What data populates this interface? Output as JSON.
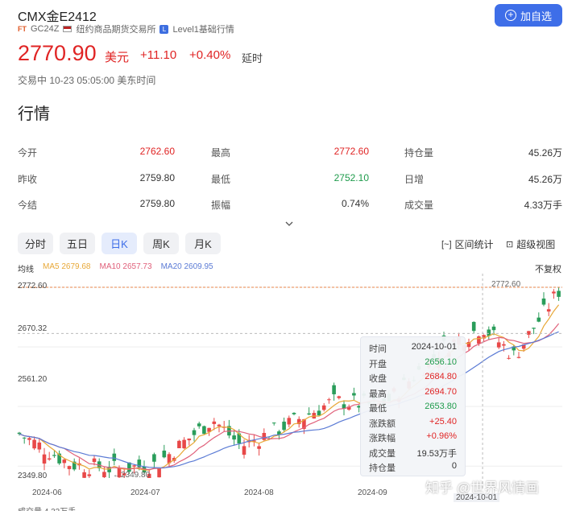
{
  "header": {
    "title": "CMX金E2412",
    "tag": "FT",
    "code": "GC24Z",
    "exchange": "纽约商品期货交易所",
    "level_badge": "L",
    "level": "Level1基础行情",
    "add_label": "加自选"
  },
  "quote": {
    "price": "2770.90",
    "unit": "美元",
    "change": "+11.10",
    "change_pct": "+0.40%",
    "delay": "延时",
    "status": "交易中 10-23 05:05:00 美东时间"
  },
  "section_title": "行情",
  "stats": [
    {
      "label": "今开",
      "value": "2762.60",
      "color": "red"
    },
    {
      "label": "最高",
      "value": "2772.60",
      "color": "red"
    },
    {
      "label": "持仓量",
      "value": "45.26万",
      "color": "blk"
    },
    {
      "label": "昨收",
      "value": "2759.80",
      "color": "blk"
    },
    {
      "label": "最低",
      "value": "2752.10",
      "color": "grn"
    },
    {
      "label": "日增",
      "value": "45.26万",
      "color": "blk"
    },
    {
      "label": "今结",
      "value": "2759.80",
      "color": "blk"
    },
    {
      "label": "振幅",
      "value": "0.74%",
      "color": "blk"
    },
    {
      "label": "成交量",
      "value": "4.33万手",
      "color": "blk"
    }
  ],
  "tabs": [
    "分时",
    "五日",
    "日K",
    "周K",
    "月K"
  ],
  "active_tab": "日K",
  "tools": {
    "range_stats": "区间统计",
    "super_view": "超级视图"
  },
  "ma": {
    "label": "均线",
    "ma5": "MA5 2679.68",
    "ma10": "MA10 2657.73",
    "ma20": "MA20 2609.95",
    "ma5_color": "#e8a838",
    "ma10_color": "#e0607a",
    "ma20_color": "#5b7bd5"
  },
  "no_adjust": "不复权",
  "axis": {
    "y_ticks": [
      "2772.60",
      "2670.32",
      "2561.20",
      "2349.80"
    ],
    "x_ticks": [
      "2024-06",
      "2024-07",
      "2024-08",
      "2024-09",
      "2024-10-01"
    ],
    "high_label": "2772.60",
    "low_label": "2349.80"
  },
  "tooltip": [
    {
      "label": "时间",
      "value": "2024-10-01",
      "color": "blk"
    },
    {
      "label": "开盘",
      "value": "2656.10",
      "color": "grn"
    },
    {
      "label": "收盘",
      "value": "2684.80",
      "color": "red"
    },
    {
      "label": "最高",
      "value": "2694.70",
      "color": "red"
    },
    {
      "label": "最低",
      "value": "2653.80",
      "color": "grn"
    },
    {
      "label": "涨跌额",
      "value": "+25.40",
      "color": "red"
    },
    {
      "label": "涨跌幅",
      "value": "+0.96%",
      "color": "red"
    },
    {
      "label": "成交量",
      "value": "19.53万手",
      "color": "blk"
    },
    {
      "label": "持仓量",
      "value": "0",
      "color": "blk"
    }
  ],
  "volume_label": "成交量 4.33万手",
  "watermark": "知乎 @世界风情画",
  "chart_data": {
    "type": "candlestick",
    "y_range": [
      2349.8,
      2772.6
    ],
    "x_range": [
      "2024-05-23",
      "2024-10-23"
    ],
    "close_trend": [
      [
        "2024-05-23",
        2450
      ],
      [
        "2024-06-07",
        2380
      ],
      [
        "2024-06-20",
        2370
      ],
      [
        "2024-07-01",
        2380
      ],
      [
        "2024-07-17",
        2480
      ],
      [
        "2024-07-25",
        2420
      ],
      [
        "2024-08-05",
        2460
      ],
      [
        "2024-08-20",
        2520
      ],
      [
        "2024-09-03",
        2510
      ],
      [
        "2024-09-20",
        2640
      ],
      [
        "2024-10-01",
        2684.8
      ],
      [
        "2024-10-10",
        2620
      ],
      [
        "2024-10-23",
        2770.9
      ]
    ],
    "crosshair_date": "2024-10-01",
    "crosshair_price": "2670.32",
    "high": "2772.60",
    "low": "2349.80"
  }
}
